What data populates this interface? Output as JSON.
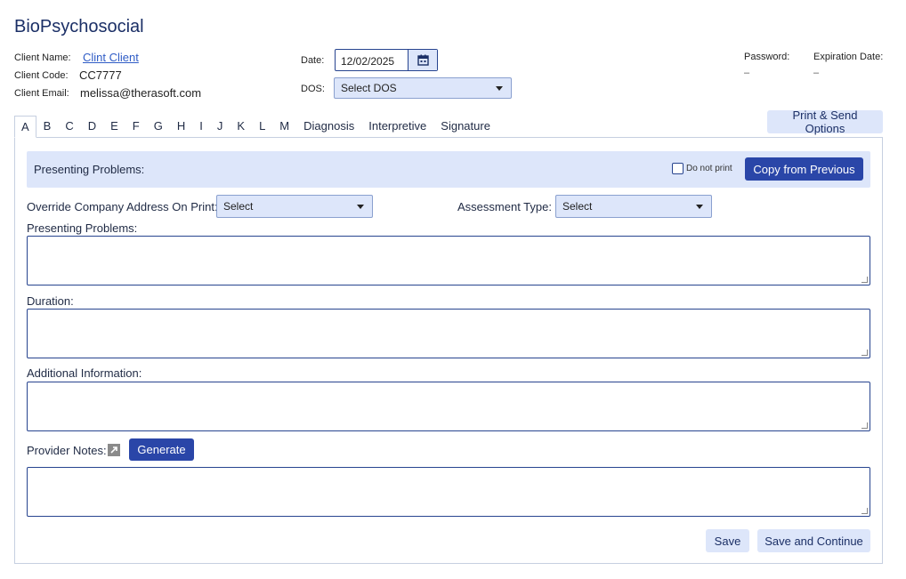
{
  "page": {
    "title": "BioPsychosocial"
  },
  "client": {
    "name_label": "Client Name:",
    "name_value": "Clint Client",
    "code_label": "Client Code:",
    "code_value": "CC7777",
    "email_label": "Client Email:",
    "email_value": "melissa@therasoft.com"
  },
  "date": {
    "label": "Date:",
    "value": "12/02/2025"
  },
  "dos": {
    "label": "DOS:",
    "value": "Select DOS"
  },
  "password": {
    "label": "Password:",
    "value": "–"
  },
  "expiration": {
    "label": "Expiration Date:",
    "value": "–"
  },
  "print_send": {
    "label": "Print & Send Options"
  },
  "tabs": [
    "A",
    "B",
    "C",
    "D",
    "E",
    "F",
    "G",
    "H",
    "I",
    "J",
    "K",
    "L",
    "M",
    "Diagnosis",
    "Interpretive",
    "Signature"
  ],
  "section": {
    "title": "Presenting Problems:",
    "do_not_print": "Do not print",
    "copy_button": "Copy from Previous"
  },
  "override": {
    "label": "Override Company Address On Print:",
    "value": "Select"
  },
  "assessment": {
    "label": "Assessment Type:",
    "value": "Select"
  },
  "fields": {
    "presenting": "Presenting Problems:",
    "duration": "Duration:",
    "additional": "Additional Information:",
    "provider_notes": "Provider Notes:"
  },
  "generate_button": "Generate",
  "footer": {
    "save": "Save",
    "save_continue": "Save and Continue"
  },
  "colors": {
    "accent": "#2a46a8",
    "light": "#dde6fa",
    "border": "#27448f"
  },
  "icons": {
    "date": "calendar-icon",
    "notes": "expand-arrow-icon"
  }
}
